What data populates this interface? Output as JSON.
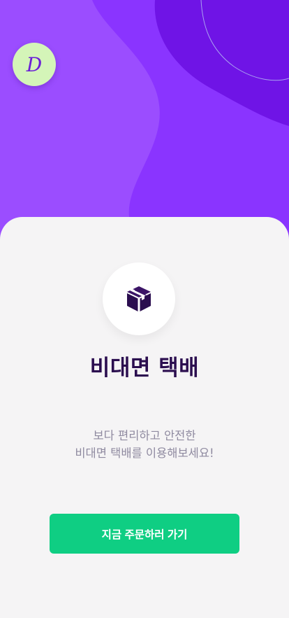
{
  "logo": {
    "letter": "D"
  },
  "hero": {
    "colors": {
      "base": "#9b4dff",
      "mid": "#8a34ff",
      "dark": "#6f14e6",
      "line": "#a9a0f0"
    }
  },
  "main": {
    "icon": "package-box-icon",
    "title": "비대면 택배",
    "description": [
      "보다 편리하고 안전한",
      "비대면 택배를 이용해보세요!"
    ],
    "cta_label": "지금 주문하러 가기"
  },
  "colors": {
    "accent": "#0fce83",
    "title": "#2b0e4f",
    "card": "#f5f4f5",
    "logo_bg": "#d4f5b8"
  }
}
